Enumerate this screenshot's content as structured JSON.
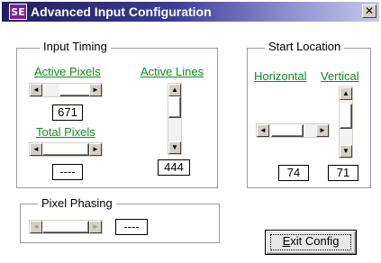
{
  "window": {
    "icon_text": "SE",
    "title": "Advanced Input Configuration",
    "close_glyph": "✕"
  },
  "input_timing": {
    "group_label": "Input Timing",
    "active_pixels_label": "Active Pixels",
    "active_pixels_value": "671",
    "total_pixels_label": "Total Pixels",
    "total_pixels_value": "----",
    "active_lines_label": "Active Lines",
    "active_lines_value": "444"
  },
  "start_location": {
    "group_label": "Start Location",
    "horizontal_label": "Horizontal",
    "horizontal_value": "74",
    "vertical_label": "Vertical",
    "vertical_value": "71"
  },
  "pixel_phasing": {
    "group_label": "Pixel Phasing",
    "value": "----"
  },
  "exit_button": {
    "label_underlined": "E",
    "label_rest": "xit Config"
  },
  "arrows": {
    "left": "◄",
    "right": "►",
    "up": "▲",
    "down": "▼"
  }
}
